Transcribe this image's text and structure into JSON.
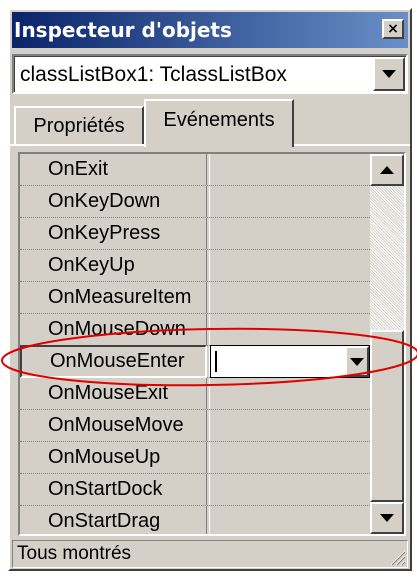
{
  "window": {
    "title": "Inspecteur d'objets",
    "close_glyph": "×",
    "colors": {
      "titlebar_start": "#0a246a",
      "titlebar_end": "#6a8fc8",
      "face": "#d4d0c8",
      "annotation": "#e00000"
    }
  },
  "combo": {
    "value": "classListBox1: TclassListBox",
    "icon": "chevron-down-icon"
  },
  "tabs": [
    {
      "label": "Propriétés",
      "active": false
    },
    {
      "label": "Evénements",
      "active": true
    }
  ],
  "events": {
    "rows": [
      {
        "name": "OnExit",
        "value": ""
      },
      {
        "name": "OnKeyDown",
        "value": ""
      },
      {
        "name": "OnKeyPress",
        "value": ""
      },
      {
        "name": "OnKeyUp",
        "value": ""
      },
      {
        "name": "OnMeasureItem",
        "value": ""
      },
      {
        "name": "OnMouseDown",
        "value": ""
      },
      {
        "name": "OnMouseEnter",
        "value": ""
      },
      {
        "name": "OnMouseExit",
        "value": ""
      },
      {
        "name": "OnMouseMove",
        "value": ""
      },
      {
        "name": "OnMouseUp",
        "value": ""
      },
      {
        "name": "OnStartDock",
        "value": ""
      },
      {
        "name": "OnStartDrag",
        "value": ""
      }
    ],
    "selected_index": 6
  },
  "scrollbar": {
    "up_icon": "scroll-up-arrow-icon",
    "down_icon": "scroll-down-arrow-icon"
  },
  "status": {
    "text": "Tous montrés"
  }
}
